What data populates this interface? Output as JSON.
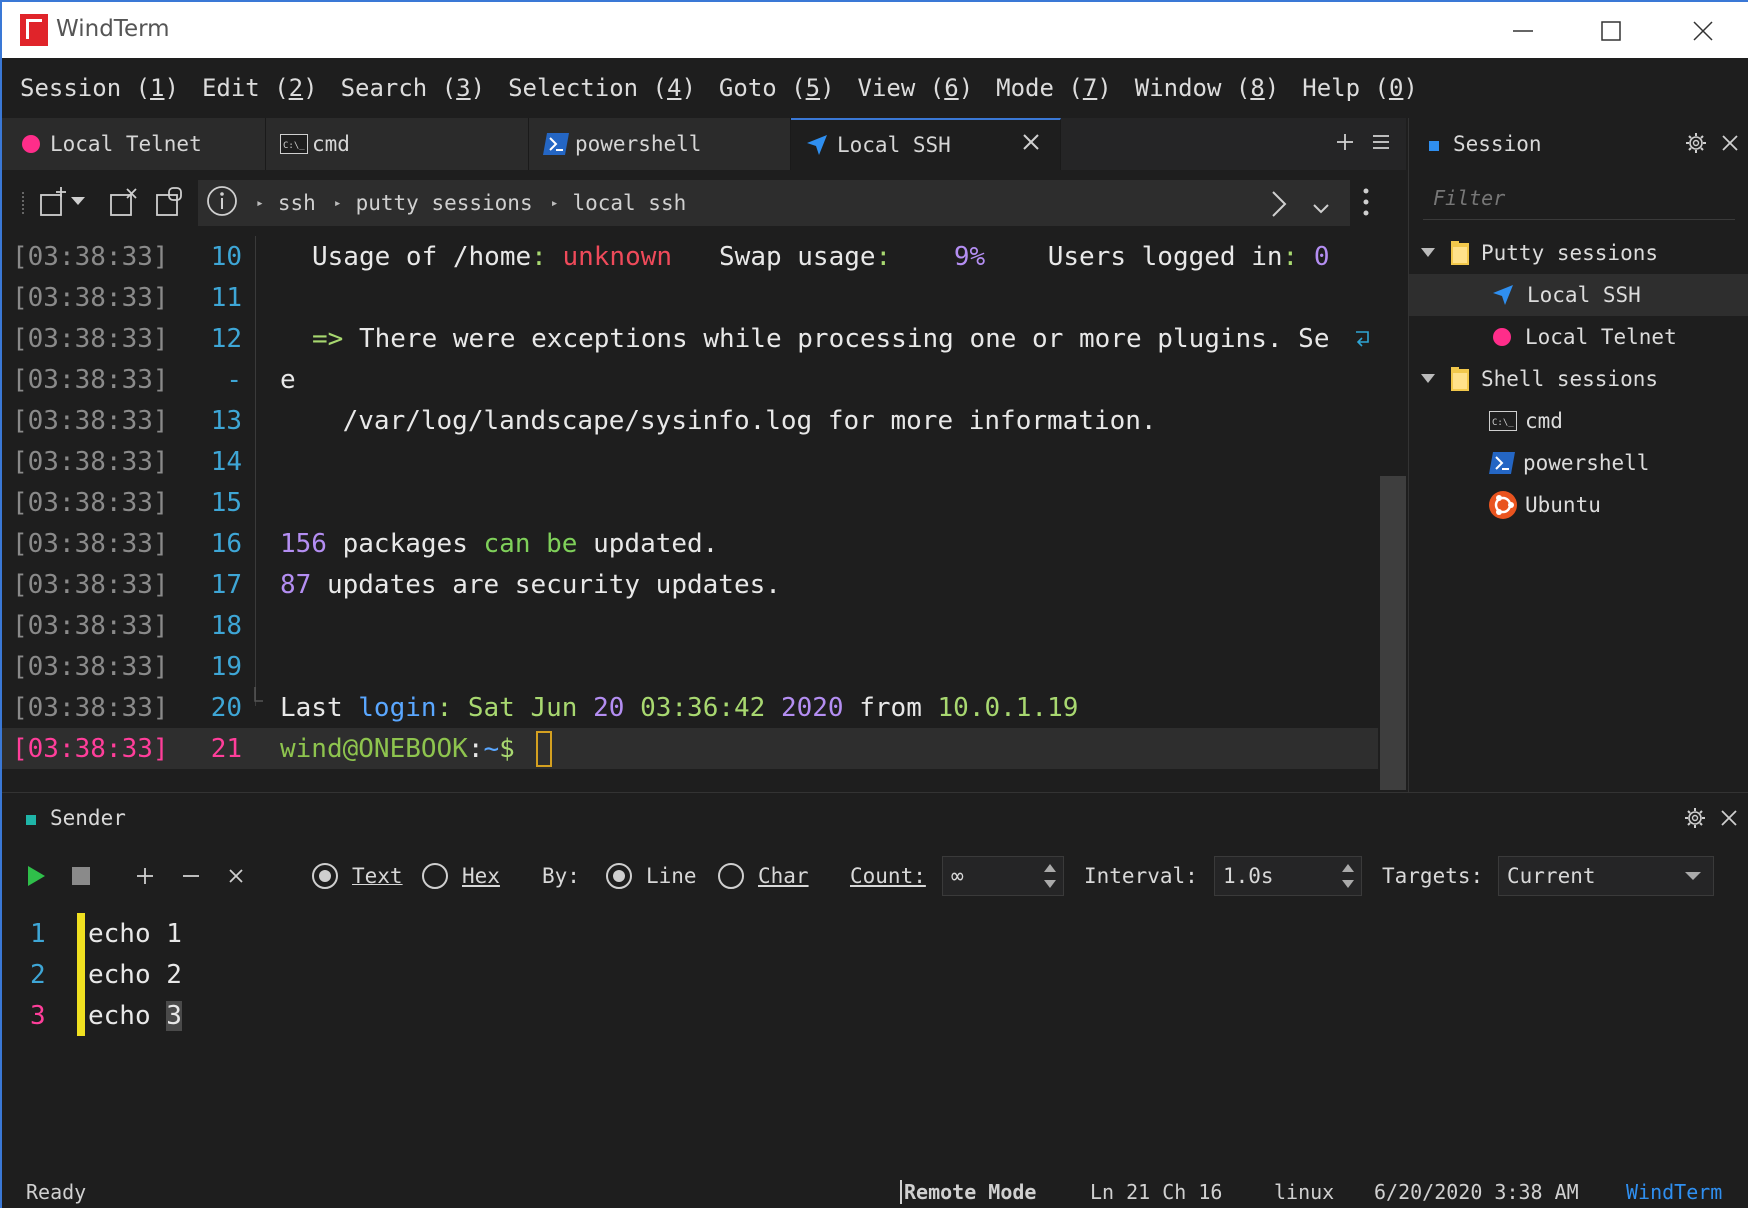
{
  "app": {
    "title": "WindTerm"
  },
  "menu": [
    {
      "pre": "Session (",
      "key": "1",
      "post": ")"
    },
    {
      "pre": "Edit (",
      "key": "2",
      "post": ")"
    },
    {
      "pre": "Search (",
      "key": "3",
      "post": ")"
    },
    {
      "pre": "Selection (",
      "key": "4",
      "post": ")"
    },
    {
      "pre": "Goto (",
      "key": "5",
      "post": ")"
    },
    {
      "pre": "View (",
      "key": "6",
      "post": ")"
    },
    {
      "pre": "Mode (",
      "key": "7",
      "post": ")"
    },
    {
      "pre": "Window (",
      "key": "8",
      "post": ")"
    },
    {
      "pre": "Help (",
      "key": "0",
      "post": ")"
    }
  ],
  "tabs": [
    {
      "label": "Local Telnet",
      "icon": "telnet-dot-icon"
    },
    {
      "label": "cmd",
      "icon": "cmd-icon"
    },
    {
      "label": "powershell",
      "icon": "powershell-icon"
    },
    {
      "label": "Local SSH",
      "icon": "ssh-arrow-icon",
      "active": true
    }
  ],
  "breadcrumb": [
    "ssh",
    "putty sessions",
    "local ssh"
  ],
  "terminal": {
    "lines": [
      {
        "ts": "[03:38:33]",
        "ln": "10"
      },
      {
        "ts": "[03:38:33]",
        "ln": "11"
      },
      {
        "ts": "[03:38:33]",
        "ln": "12"
      },
      {
        "ts": "[03:38:33]",
        "ln": "-"
      },
      {
        "ts": "[03:38:33]",
        "ln": "13"
      },
      {
        "ts": "[03:38:33]",
        "ln": "14"
      },
      {
        "ts": "[03:38:33]",
        "ln": "15"
      },
      {
        "ts": "[03:38:33]",
        "ln": "16"
      },
      {
        "ts": "[03:38:33]",
        "ln": "17"
      },
      {
        "ts": "[03:38:33]",
        "ln": "18"
      },
      {
        "ts": "[03:38:33]",
        "ln": "19"
      },
      {
        "ts": "[03:38:33]",
        "ln": "20"
      },
      {
        "ts": "[03:38:33]",
        "ln": "21"
      }
    ],
    "l10": {
      "a": "Usage of /home",
      "b": ":",
      "c": " unknown",
      "d": "   Swap usage",
      "e": ":",
      "f": "    9%",
      "g": "    Users logged in",
      "h": ":",
      "i": " 0"
    },
    "l12": {
      "arrow": "=>",
      "text": " There were exceptions while processing one or more plugins. Se"
    },
    "l12b": "e",
    "l13": "    /var/log/landscape/sysinfo.log for more information.",
    "l16": {
      "n": "156",
      "a": " packages ",
      "b": "can",
      "c": " ",
      "d": "be",
      "e": " updated."
    },
    "l17": {
      "n": "87",
      "a": " updates are security updates."
    },
    "l20": {
      "a": "Last ",
      "b": "login",
      "c": ": ",
      "d": "Sat Jun ",
      "e": "20",
      "f": " ",
      "g": "03:36:42",
      "h": " ",
      "i": "2020",
      "j": " from ",
      "k": "10.0.1.19"
    },
    "l21": {
      "user": "wind@ONEBOOK",
      "colon": ":",
      "path": "~",
      "prompt": "$ "
    }
  },
  "session_panel": {
    "title": "Session",
    "filter_placeholder": "Filter",
    "tree": [
      {
        "label": "Putty sessions",
        "type": "folder"
      },
      {
        "label": "Local SSH",
        "type": "ssh",
        "selected": true
      },
      {
        "label": "Local Telnet",
        "type": "telnet"
      },
      {
        "label": "Shell sessions",
        "type": "folder"
      },
      {
        "label": "cmd",
        "type": "cmd"
      },
      {
        "label": "powershell",
        "type": "powershell"
      },
      {
        "label": "Ubuntu",
        "type": "ubuntu"
      }
    ]
  },
  "sender": {
    "title": "Sender",
    "text_label": "Text",
    "hex_label": "Hex",
    "by_label": "By:",
    "line_label": "Line",
    "char_label": "Char",
    "count_label": "Count:",
    "count_value": "∞",
    "interval_label": "Interval:",
    "interval_value": "1.0s",
    "targets_label": "Targets:",
    "targets_value": "Current",
    "lines": [
      {
        "num": "1",
        "pre": "echo 1",
        "post": ""
      },
      {
        "num": "2",
        "pre": "echo 2",
        "post": ""
      },
      {
        "num": "3",
        "pre": "echo ",
        "post": "3"
      }
    ]
  },
  "status": {
    "left": "Ready",
    "mode": "Remote Mode",
    "position": "Ln 21 Ch 16",
    "os": "linux",
    "datetime": "6/20/2020 3:38 AM",
    "brand": "WindTerm"
  },
  "colors": {
    "accent": "#3a78d6",
    "brand_red": "#e0242a",
    "timestamp_current": "#ff3e9a",
    "line_number": "#3ea6d6",
    "cursor": "#d4a020"
  }
}
